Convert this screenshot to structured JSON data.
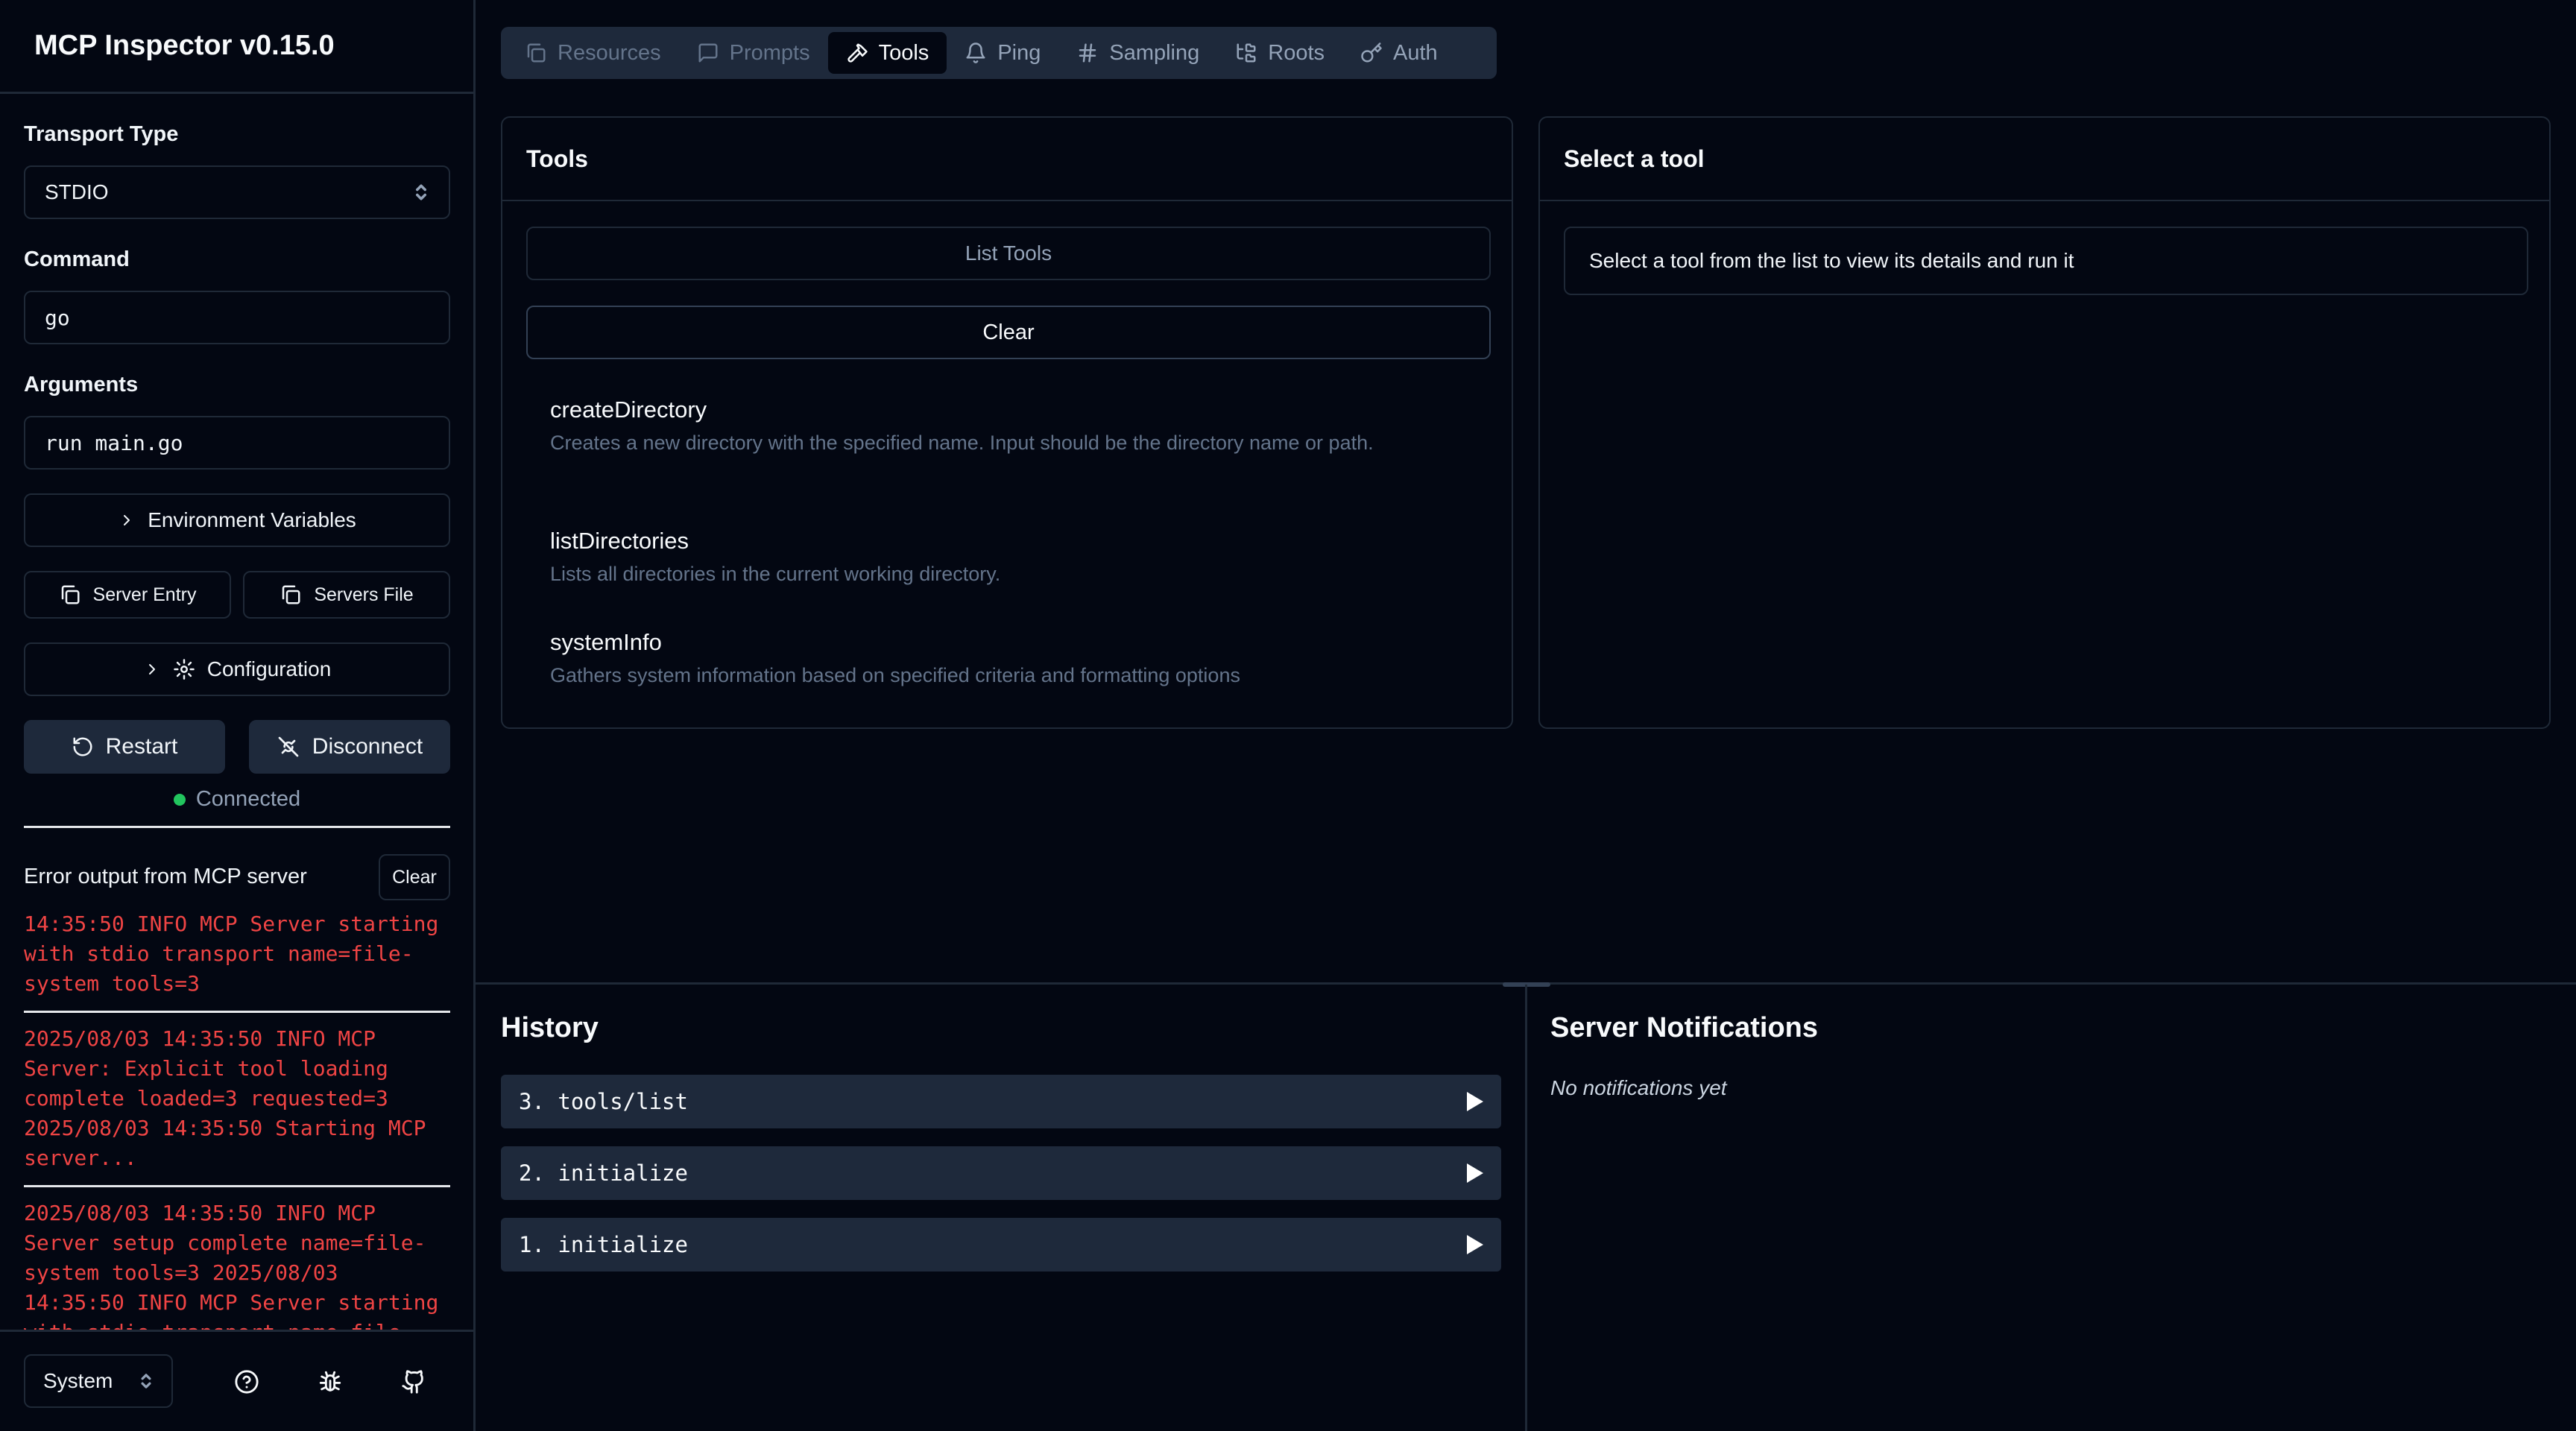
{
  "app": {
    "title": "MCP Inspector v0.15.0"
  },
  "sidebar": {
    "transport_label": "Transport Type",
    "transport_value": "STDIO",
    "command_label": "Command",
    "command_value": "go",
    "arguments_label": "Arguments",
    "arguments_value": "run main.go",
    "env_button": "Environment Variables",
    "server_entry_button": "Server Entry",
    "servers_file_button": "Servers File",
    "config_button": "Configuration",
    "restart_button": "Restart",
    "disconnect_button": "Disconnect",
    "status": "Connected",
    "status_color": "#22c55e",
    "error_title": "Error output from MCP server",
    "error_clear": "Clear",
    "errors": [
      "14:35:50 INFO MCP Server starting\nwith stdio transport name=file-\nsystem tools=3",
      "2025/08/03 14:35:50 INFO MCP\nServer: Explicit tool loading\ncomplete loaded=3 requested=3\n2025/08/03 14:35:50 Starting MCP\nserver...",
      "2025/08/03 14:35:50 INFO MCP\nServer setup complete name=file-\nsystem tools=3 2025/08/03\n14:35:50 INFO MCP Server starting\nwith stdio transport name=file-"
    ],
    "theme_value": "System"
  },
  "tabs": [
    {
      "label": "Resources",
      "icon": "files-icon"
    },
    {
      "label": "Prompts",
      "icon": "message-icon"
    },
    {
      "label": "Tools",
      "icon": "hammer-icon"
    },
    {
      "label": "Ping",
      "icon": "bell-icon"
    },
    {
      "label": "Sampling",
      "icon": "hash-icon"
    },
    {
      "label": "Roots",
      "icon": "folder-tree-icon"
    },
    {
      "label": "Auth",
      "icon": "key-icon"
    }
  ],
  "tools_panel": {
    "title": "Tools",
    "list_button": "List Tools",
    "clear_button": "Clear",
    "tools": [
      {
        "name": "createDirectory",
        "description": "Creates a new directory with the specified name. Input should be the directory name or path."
      },
      {
        "name": "listDirectories",
        "description": "Lists all directories in the current working directory."
      },
      {
        "name": "systemInfo",
        "description": "Gathers system information based on specified criteria and formatting options"
      }
    ]
  },
  "select_panel": {
    "title": "Select a tool",
    "message": "Select a tool from the list to view its details and run it"
  },
  "history": {
    "title": "History",
    "items": [
      "3. tools/list",
      "2. initialize",
      "1. initialize"
    ]
  },
  "notifications": {
    "title": "Server Notifications",
    "empty": "No notifications yet"
  }
}
